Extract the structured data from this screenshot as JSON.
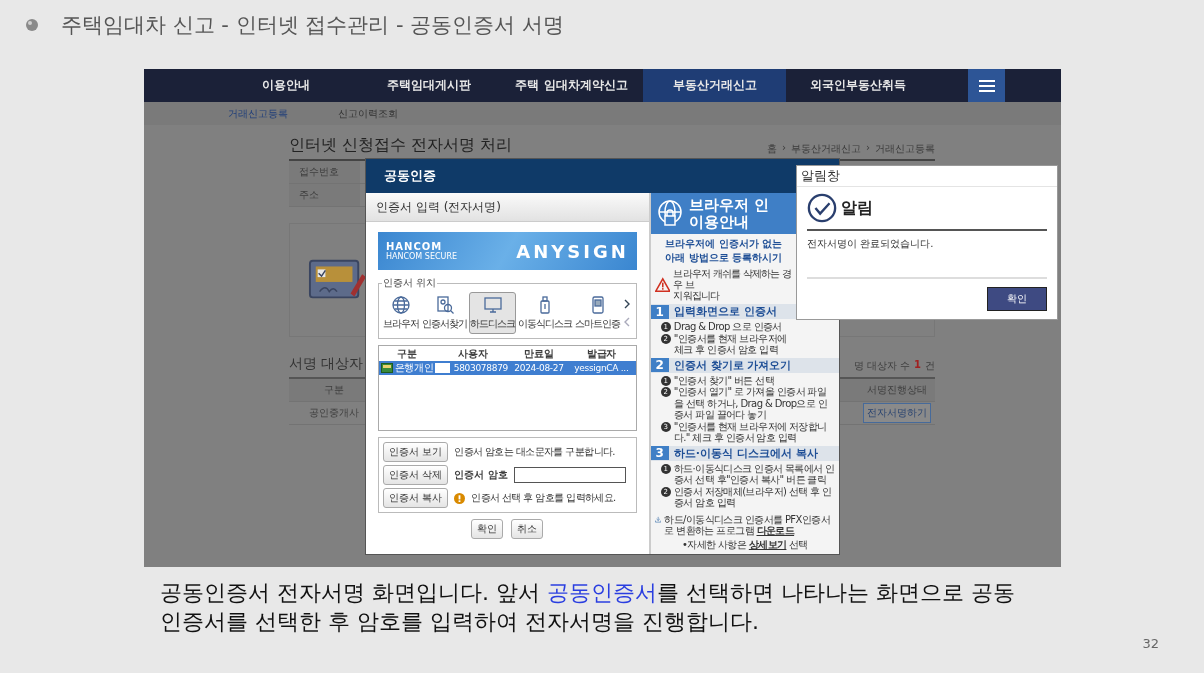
{
  "slide": {
    "title": "주택임대차 신고 - 인터넷 접수관리 - 공동인증서 서명",
    "caption": [
      {
        "kind": "plain",
        "text": "공동인증서 전자서명 화면입니다. 앞서 "
      },
      {
        "kind": "link",
        "text": "공동인증서"
      },
      {
        "kind": "plain",
        "text": "를 선택하면 나타나는 화면으로 공동 인증서를 선택한 후 암호를 입력하여 전자서명을 진행합니다."
      }
    ],
    "page_number": "32"
  },
  "screenshot": {
    "nav": [
      {
        "label": "이용안내",
        "selected": false
      },
      {
        "label": "주택임대게시판",
        "selected": false
      },
      {
        "label": "주택 임대차계약신고",
        "selected": false
      },
      {
        "label": "부동산거래신고",
        "selected": true
      },
      {
        "label": "외국인부동산취득",
        "selected": false
      }
    ],
    "subnav": [
      {
        "label": "거래신고등록",
        "selected": true
      },
      {
        "label": "신고이력조회",
        "selected": false
      }
    ],
    "page": {
      "heading": "인터넷 신청접수 전자서명 처리",
      "breadcrumb": [
        "홈",
        "부동산거래신고",
        "거래신고등록"
      ],
      "breadcrumb_separator": "›",
      "info_labels": [
        "접수번호",
        "주소"
      ],
      "signers": {
        "title": "서명 대상자",
        "count_label": "명 대상자 수",
        "count": "1",
        "count_unit": "건",
        "columns": [
          "구분",
          "서명진행상태"
        ],
        "row": {
          "type": "공인중개사",
          "action": "전자서명하기"
        }
      }
    },
    "cert_dialog": {
      "title": "공동인증",
      "panel_title": "인증서 입력 (전자서명)",
      "logo": "HANCOM",
      "logo_sub": "HANCOM SECURE",
      "brand": "ANYSIGN",
      "location_legend": "인증서 위치",
      "locations": [
        {
          "kind": "browser",
          "label": "브라우저",
          "selected": false
        },
        {
          "kind": "search",
          "label": "인증서찾기",
          "selected": false
        },
        {
          "kind": "harddisk",
          "label": "하드디스크",
          "selected": true
        },
        {
          "kind": "usb",
          "label": "이동식디스크",
          "selected": false
        },
        {
          "kind": "phone",
          "label": "스마트인증",
          "selected": false
        }
      ],
      "columns": [
        "구분",
        "사용자",
        "만료일",
        "발급자"
      ],
      "certs": [
        {
          "type": "은행개인",
          "user": "5803078879",
          "user_masked": true,
          "expiry": "2024-08-27",
          "issuer": "yessignCA ...",
          "selected": true
        }
      ],
      "buttons": [
        "인증서 보기",
        "인증서 삭제",
        "인증서 복사"
      ],
      "case_hint": "인증서 암호는 대소문자를 구분합니다.",
      "password_label": "인증서 암호",
      "select_hint": "인증서 선택 후 암호를 입력하세요.",
      "actions": [
        "확인",
        "취소"
      ],
      "guide": {
        "title": [
          "브라우저 인",
          "이용안내"
        ],
        "intro": [
          "브라우저에 인증서가 없는",
          "아래 방법으로 등록하시기"
        ],
        "warning": [
          "브라우저 캐쉬를 삭제하는 경우 브",
          "지워집니다"
        ],
        "sections": [
          {
            "number": "1",
            "title": "입력화면으로 인증서",
            "steps": [
              {
                "n": "1",
                "text": "Drag & Drop 으로 인증서"
              },
              {
                "n": "2",
                "text": "\"인증서를 현재 브라우저에 체크 후 인증서 암호 입력"
              }
            ]
          },
          {
            "number": "2",
            "title": "인증서 찾기로 가져오기",
            "steps": [
              {
                "n": "1",
                "text": "\"인증서 찾기\" 버튼 선택"
              },
              {
                "n": "2",
                "text": "\"인증서 열기\" 로 가져올 인증서 파일을 선택 하거나, Drag & Drop으로 인증서 파일 끌어다 놓기"
              },
              {
                "n": "3",
                "text": "\"인증서를 현재 브라우저에 저장합니다.\" 체크 후 인증서 암호 입력"
              }
            ]
          },
          {
            "number": "3",
            "title": "하드·이동식 디스크에서 복사",
            "steps": [
              {
                "n": "1",
                "text": "하드·이동식디스크 인증서 목록에서 인증서 선택 후\"인증서 복사\" 버튼 클릭"
              },
              {
                "n": "2",
                "text": "인증서 저장매체(브라우저) 선택 후 인증서 암호 입력"
              }
            ]
          }
        ],
        "download": [
          {
            "kind": "plain",
            "text": "하드/이동식디스크 인증서를 PFX인증서로 변환하는 프로그램 "
          },
          {
            "kind": "link",
            "text": "다운로드"
          }
        ],
        "more": [
          {
            "kind": "plain",
            "text": "•자세한 사항은 "
          },
          {
            "kind": "link",
            "text": "상세보기"
          },
          {
            "kind": "plain",
            "text": " 선택"
          }
        ]
      }
    },
    "alert": {
      "window_title": "알림창",
      "heading": "알림",
      "message": "전자서명이 완료되었습니다.",
      "button": "확인"
    }
  }
}
